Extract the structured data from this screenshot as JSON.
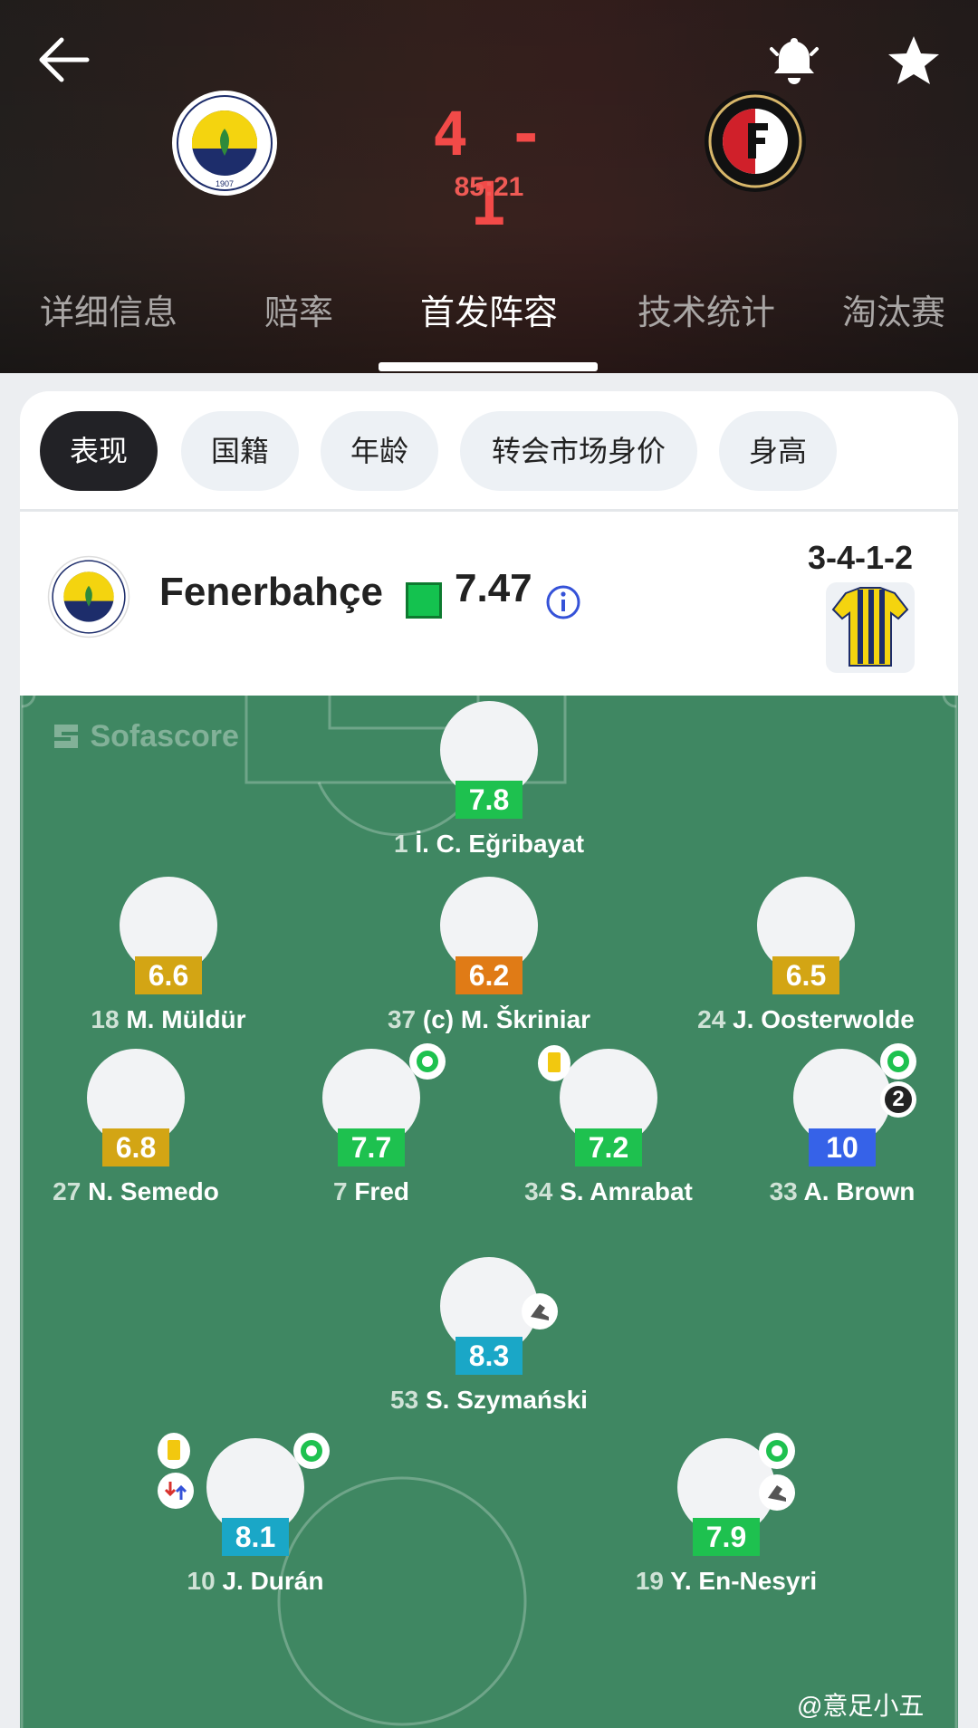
{
  "match": {
    "score": "4 - 1",
    "clock": "85:21",
    "home_team": "Fenerbahçe",
    "away_team": "Feyenoord"
  },
  "tabs": [
    "详细信息",
    "赔率",
    "首发阵容",
    "技术统计",
    "淘汰赛"
  ],
  "active_tab": "首发阵容",
  "filters": [
    "表现",
    "国籍",
    "年龄",
    "转会市场身价",
    "身高"
  ],
  "team": {
    "name": "Fenerbahçe",
    "rating": "7.47",
    "formation": "3-4-1-2"
  },
  "watermark": "Sofascore",
  "players": [
    {
      "num": "1",
      "name": "İ. C. Eğribayat",
      "rating": "7.8",
      "rating_color": "#1ec14f"
    },
    {
      "num": "18",
      "name": "M. Müldür",
      "rating": "6.6",
      "rating_color": "#d3a514"
    },
    {
      "num": "37",
      "name": "(c) M. Škriniar",
      "rating": "6.2",
      "rating_color": "#e07b16"
    },
    {
      "num": "24",
      "name": "J. Oosterwolde",
      "rating": "6.5",
      "rating_color": "#d3a514"
    },
    {
      "num": "27",
      "name": "N. Semedo",
      "rating": "6.8",
      "rating_color": "#d3a514"
    },
    {
      "num": "7",
      "name": "Fred",
      "rating": "7.7",
      "rating_color": "#1ec14f"
    },
    {
      "num": "34",
      "name": "S. Amrabat",
      "rating": "7.2",
      "rating_color": "#1ec14f"
    },
    {
      "num": "33",
      "name": "A. Brown",
      "rating": "10",
      "rating_color": "#3662e8"
    },
    {
      "num": "53",
      "name": "S. Szymański",
      "rating": "8.3",
      "rating_color": "#1aa7c7"
    },
    {
      "num": "10",
      "name": "J. Durán",
      "rating": "8.1",
      "rating_color": "#1aa7c7"
    },
    {
      "num": "19",
      "name": "Y. En-Nesyri",
      "rating": "7.9",
      "rating_color": "#1ec14f"
    }
  ],
  "brown_goals": "2",
  "corner_watermark": "@意足小五"
}
